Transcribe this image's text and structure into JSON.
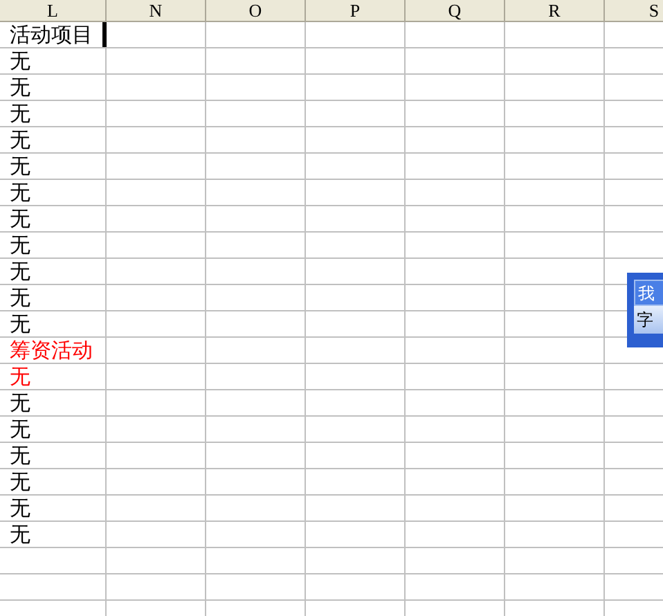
{
  "columns": [
    "L",
    "N",
    "O",
    "P",
    "Q",
    "R",
    "S"
  ],
  "rows": [
    {
      "text": "活动项目",
      "color": "#000000",
      "selected": true
    },
    {
      "text": "无",
      "color": "#000000",
      "selected": false
    },
    {
      "text": "无",
      "color": "#000000",
      "selected": false
    },
    {
      "text": "无",
      "color": "#000000",
      "selected": false
    },
    {
      "text": "无",
      "color": "#000000",
      "selected": false
    },
    {
      "text": "无",
      "color": "#000000",
      "selected": false
    },
    {
      "text": "无",
      "color": "#000000",
      "selected": false
    },
    {
      "text": "无",
      "color": "#000000",
      "selected": false
    },
    {
      "text": "无",
      "color": "#000000",
      "selected": false
    },
    {
      "text": "无",
      "color": "#000000",
      "selected": false
    },
    {
      "text": "无",
      "color": "#000000",
      "selected": false
    },
    {
      "text": "无",
      "color": "#000000",
      "selected": false
    },
    {
      "text": "筹资活动",
      "color": "#ff0000",
      "selected": false
    },
    {
      "text": "无",
      "color": "#ff0000",
      "selected": false
    },
    {
      "text": "无",
      "color": "#000000",
      "selected": false
    },
    {
      "text": "无",
      "color": "#000000",
      "selected": false
    },
    {
      "text": "无",
      "color": "#000000",
      "selected": false
    },
    {
      "text": "无",
      "color": "#000000",
      "selected": false
    },
    {
      "text": "无",
      "color": "#000000",
      "selected": false
    },
    {
      "text": "无",
      "color": "#000000",
      "selected": false
    }
  ],
  "floating_toolbar": {
    "title": "我",
    "item": "字"
  }
}
